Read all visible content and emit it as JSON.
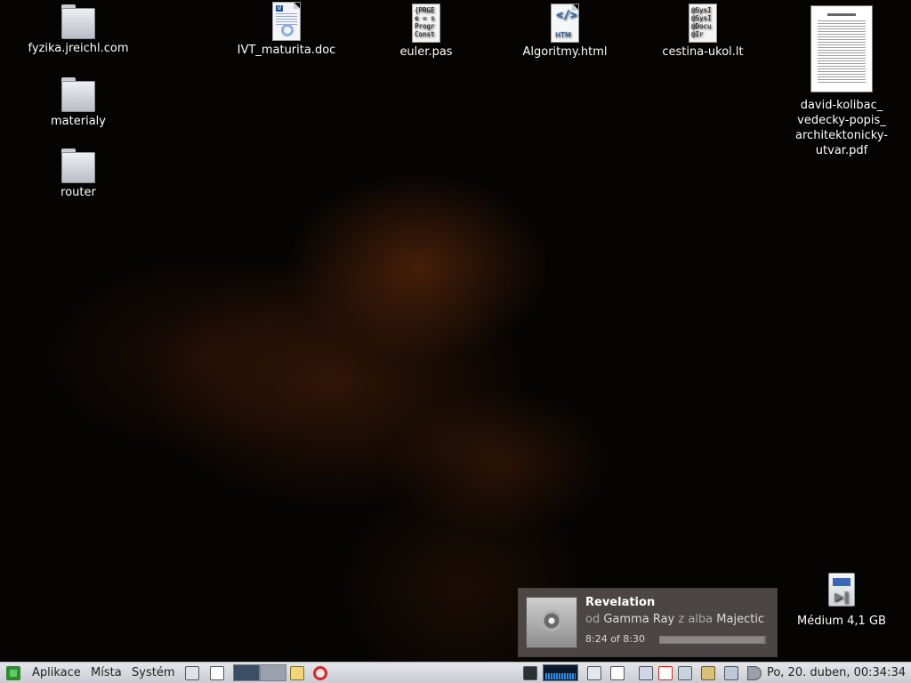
{
  "desktop": {
    "icons": {
      "fyzika": {
        "label": "fyzika.jreichl.com"
      },
      "materialy": {
        "label": "materialy"
      },
      "router": {
        "label": "router"
      },
      "ivt": {
        "label": "IVT_maturita.doc"
      },
      "euler": {
        "label": "euler.pas",
        "preview": "{PRGE\ne = s\nProgr\nConst"
      },
      "algoritmy": {
        "label": "Algoritmy.html",
        "preview": "HTM"
      },
      "cestina": {
        "label": "cestina-ukol.lt",
        "preview": "@SysI\n@SysI\n@Docu\n@Ir"
      },
      "pdf": {
        "label": "david-kolibac_\nvedecky-popis_\narchitektonicky-\nutvar.pdf"
      },
      "medium": {
        "label": "Médium 4,1 GB"
      }
    }
  },
  "notification": {
    "title": "Revelation",
    "by_label": "od",
    "artist": "Gamma Ray",
    "from_label": "z alba",
    "album": "Majectic",
    "time": "8:24 of 8:30",
    "progress": 0.99
  },
  "panel": {
    "menus": {
      "applications": "Aplikace",
      "places": "Místa",
      "system": "Systém"
    },
    "clock": "Po, 20. duben, 00:34:34"
  },
  "colors": {
    "panel": "#d6d8dc",
    "notification": "#5a5654",
    "accent_green": "#2f8a2f"
  }
}
